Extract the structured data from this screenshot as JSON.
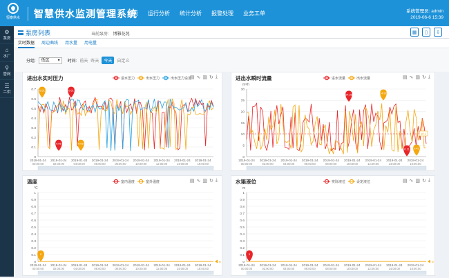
{
  "app": {
    "logo_text": "恒泰供水",
    "title": "智慧供水监测管理系统",
    "nav": [
      "首页",
      "运行分析",
      "统计分析",
      "报警处理",
      "业务工单"
    ],
    "user_line1": "系统管理员: admin",
    "user_line2": "2019-06-6  15:39"
  },
  "sidebar": {
    "items": [
      {
        "label": "泵房",
        "icon": "gear-icon"
      },
      {
        "label": "水厂",
        "icon": "building-icon"
      },
      {
        "label": "管网",
        "icon": "pipe-icon"
      },
      {
        "label": "二供",
        "icon": "list-icon"
      }
    ]
  },
  "header": {
    "list_title": "泵房列表",
    "crumb_label": "当前泵房:",
    "crumb_value": "博雅花苑"
  },
  "tabs": [
    "实时数据",
    "周边曲线",
    "用水量",
    "用电量"
  ],
  "filter": {
    "zone_label": "分组:",
    "zone_value": "低区",
    "time_label": "时间:",
    "options": [
      "前天",
      "昨天",
      "今天",
      "自定义"
    ],
    "active": "今天"
  },
  "colors": {
    "red": "#e8262a",
    "orange": "#f5a70f",
    "blue": "#2aa3e0",
    "accent": "#1e92d8"
  },
  "charts": {
    "x_ticks": [
      "2019-01-24\n00:00:00",
      "2019-01-24\n02:00:00",
      "2019-01-24\n04:00:00",
      "2019-01-24\n06:00:00",
      "2019-01-24\n08:00:00",
      "2019-01-24\n10:00:00",
      "2019-01-24\n12:00:00",
      "2019-01-24\n14:00:00",
      "2019-01-24\n16:00:00"
    ]
  },
  "chart_data": [
    {
      "type": "line",
      "title": "进出水实时压力",
      "ylabel": "",
      "ylim": [
        0,
        0.7
      ],
      "yticks": [
        0,
        0.1,
        0.2,
        0.3,
        0.4,
        0.5,
        0.6,
        0.7
      ],
      "series": [
        {
          "name": "进水压力",
          "color": "#e8262a"
        },
        {
          "name": "出水压力",
          "color": "#f5a70f"
        },
        {
          "name": "出水压力设定",
          "color": "#2aa3e0"
        }
      ],
      "markers": [
        {
          "label": "0.61",
          "series": "出水压力",
          "pos": "max"
        },
        {
          "label": "0.61",
          "series": "进水压力",
          "pos": "max"
        },
        {
          "label": "0.06",
          "series": "进水压力",
          "pos": "min"
        },
        {
          "label": "0.06",
          "series": "出水压力",
          "pos": "min"
        }
      ]
    },
    {
      "type": "line",
      "title": "进出水瞬时流量",
      "ylabel": "m³/h",
      "ylim": [
        0,
        30
      ],
      "yticks": [
        0,
        5,
        10,
        15,
        20,
        25,
        30
      ],
      "series": [
        {
          "name": "进水流量",
          "color": "#e8262a"
        },
        {
          "name": "出水流量",
          "color": "#f5a70f"
        }
      ],
      "avg_label": "10.1",
      "markers": [
        {
          "label": "24.35",
          "series": "进水流量",
          "pos": "max"
        },
        {
          "label": "24.92",
          "series": "出水流量",
          "pos": "max"
        },
        {
          "label": "0.11",
          "series": "进水流量",
          "pos": "min"
        },
        {
          "label": "0.42",
          "series": "出水流量",
          "pos": "min"
        }
      ]
    },
    {
      "type": "line",
      "title": "温度",
      "ylabel": "°C",
      "ylim": [
        0,
        1
      ],
      "yticks": [
        0,
        0.1,
        0.2,
        0.3,
        0.4,
        0.5,
        0.6,
        0.7,
        0.8,
        0.9,
        1
      ],
      "series": [
        {
          "name": "室内温度",
          "color": "#e8262a"
        },
        {
          "name": "室外温度",
          "color": "#f5a70f"
        }
      ],
      "markers": [
        {
          "label": "0",
          "series": "室外温度",
          "pos": "start"
        }
      ],
      "end_label": "0"
    },
    {
      "type": "line",
      "title": "水箱液位",
      "ylabel": "m",
      "ylim": [
        0,
        1
      ],
      "yticks": [
        0,
        0.1,
        0.2,
        0.3,
        0.4,
        0.5,
        0.6,
        0.7,
        0.8,
        0.9,
        1
      ],
      "series": [
        {
          "name": "实际液位",
          "color": "#e8262a"
        },
        {
          "name": "设定液位",
          "color": "#f5a70f"
        }
      ],
      "markers": [
        {
          "label": "0",
          "series": "实际液位",
          "pos": "start"
        }
      ],
      "end_label": "0"
    }
  ]
}
